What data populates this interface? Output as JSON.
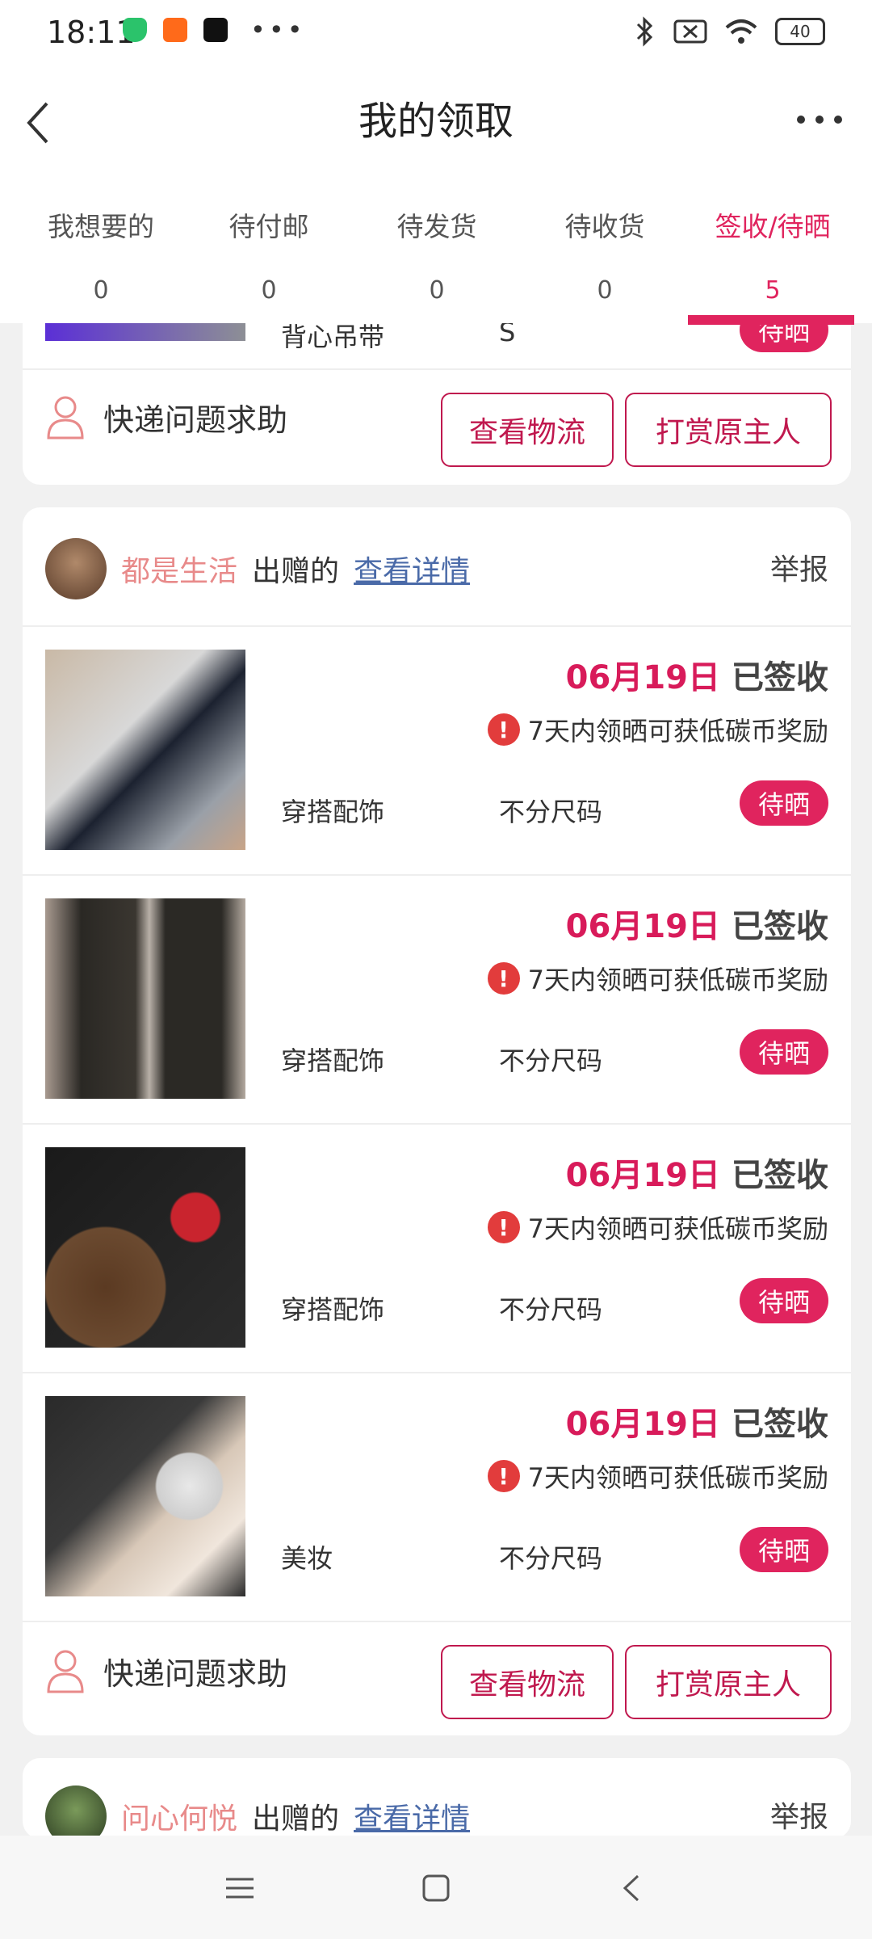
{
  "status": {
    "time": "18:11",
    "battery": "40"
  },
  "header": {
    "title": "我的领取"
  },
  "tabs": [
    {
      "label": "我想要的",
      "count": "0"
    },
    {
      "label": "待付邮",
      "count": "0"
    },
    {
      "label": "待发货",
      "count": "0"
    },
    {
      "label": "待收货",
      "count": "0"
    },
    {
      "label": "签收/待晒",
      "count": "5"
    }
  ],
  "top_card": {
    "partial_category": "背心吊带",
    "partial_size": "S",
    "partial_badge": "待晒",
    "help": "快递问题求助",
    "logistics": "查看物流",
    "tip": "打赏原主人"
  },
  "main_card": {
    "seller": "都是生活",
    "gift_text": "出赠的",
    "detail": "查看详情",
    "report": "举报",
    "items": [
      {
        "date": "06月19日",
        "status": "已签收",
        "reward": "7天内领晒可获低碳币奖励",
        "category": "穿搭配饰",
        "size": "不分尺码",
        "badge": "待晒"
      },
      {
        "date": "06月19日",
        "status": "已签收",
        "reward": "7天内领晒可获低碳币奖励",
        "category": "穿搭配饰",
        "size": "不分尺码",
        "badge": "待晒"
      },
      {
        "date": "06月19日",
        "status": "已签收",
        "reward": "7天内领晒可获低碳币奖励",
        "category": "穿搭配饰",
        "size": "不分尺码",
        "badge": "待晒"
      },
      {
        "date": "06月19日",
        "status": "已签收",
        "reward": "7天内领晒可获低碳币奖励",
        "category": "美妆",
        "size": "不分尺码",
        "badge": "待晒"
      }
    ],
    "help": "快递问题求助",
    "logistics": "查看物流",
    "tip": "打赏原主人"
  },
  "bottom_card": {
    "seller": "问心何悦",
    "gift_text": "出赠的",
    "detail": "查看详情",
    "report": "举报"
  }
}
